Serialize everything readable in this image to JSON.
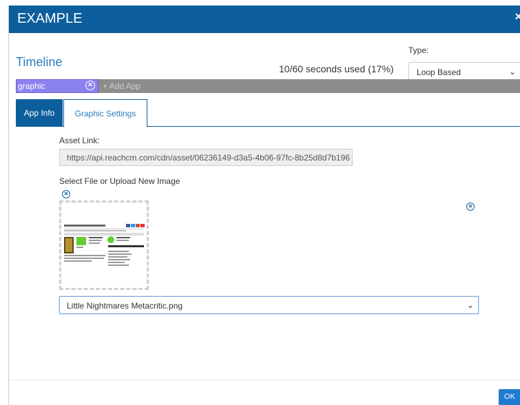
{
  "header": {
    "title": "EXAMPLE",
    "close_glyph": "×"
  },
  "timeline": {
    "title": "Timeline",
    "seconds_used": "10/60 seconds used (17%)"
  },
  "type": {
    "label": "Type:",
    "selected": "Loop Based"
  },
  "appbar": {
    "chip_label": "graphic",
    "add_app_label": "+ Add App"
  },
  "tabs": [
    {
      "label": "App Info"
    },
    {
      "label": "Graphic Settings"
    }
  ],
  "asset": {
    "label": "Asset Link:",
    "value": "https://api.reachcm.com/cdn/asset/06236149-d3a5-4b06-97fc-8b25d8d7b196"
  },
  "upload": {
    "label": "Select File or Upload New Image",
    "selected_file": "Little Nightmares Metacritic.png"
  },
  "footer": {
    "ok_label": "OK"
  },
  "colors": {
    "header_bg": "#0d5e9c",
    "accent_text": "#2a7cbf",
    "chip_bg": "#8b82f0",
    "appbar_bg": "#8c8c8c",
    "ok_bg": "#1f7bd0"
  }
}
